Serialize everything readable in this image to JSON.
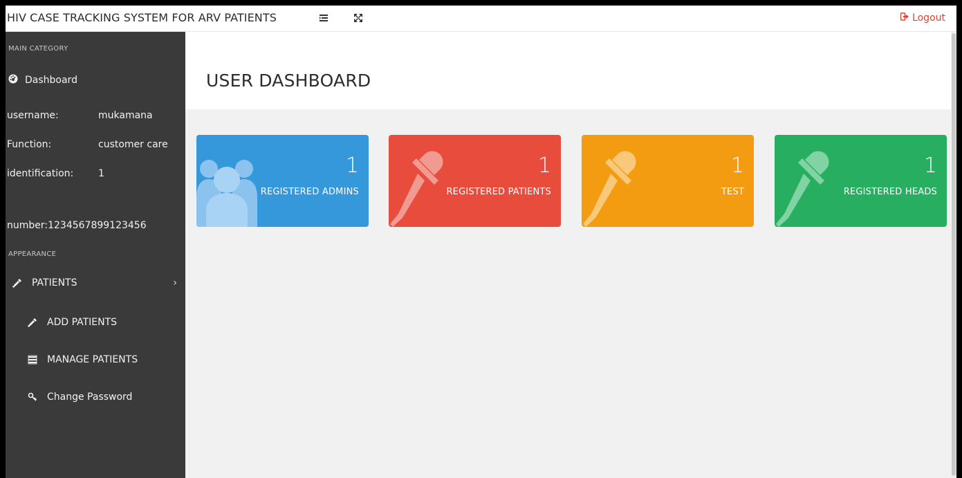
{
  "topbar": {
    "title": "HIV CASE TRACKING SYSTEM FOR ARV PATIENTS",
    "menu_icon": "list-toggle-icon",
    "fullscreen_icon": "expand-icon",
    "logout_label": "Logout",
    "logout_color": "#e0412f"
  },
  "sidebar": {
    "main_category": "MAIN CATEGORY",
    "dashboard_label": "Dashboard",
    "username_label": "username:",
    "username_value": "mukamana",
    "function_label": "Function:",
    "function_value": "customer care",
    "identification_label": "identification:",
    "identification_value": "1",
    "number_text": "number:1234567899123456",
    "appearance": "APPEARANCE",
    "patients_label": "PATIENTS",
    "add_patients_label": "ADD PATIENTS",
    "manage_patients_label": "MANAGE PATIENTS",
    "change_password_label": "Change Password"
  },
  "main": {
    "page_title": "USER DASHBOARD",
    "cards": [
      {
        "count": "1",
        "label": "REGISTERED ADMINS",
        "color": "#3498db",
        "icon": "users-icon"
      },
      {
        "count": "1",
        "label": "REGISTERED PATIENTS",
        "color": "#e74c3c",
        "icon": "eyedropper-icon"
      },
      {
        "count": "1",
        "label": "TEST",
        "color": "#f39c12",
        "icon": "eyedropper-icon"
      },
      {
        "count": "1",
        "label": "REGISTERED HEADS",
        "color": "#27ae60",
        "icon": "eyedropper-icon"
      }
    ]
  }
}
